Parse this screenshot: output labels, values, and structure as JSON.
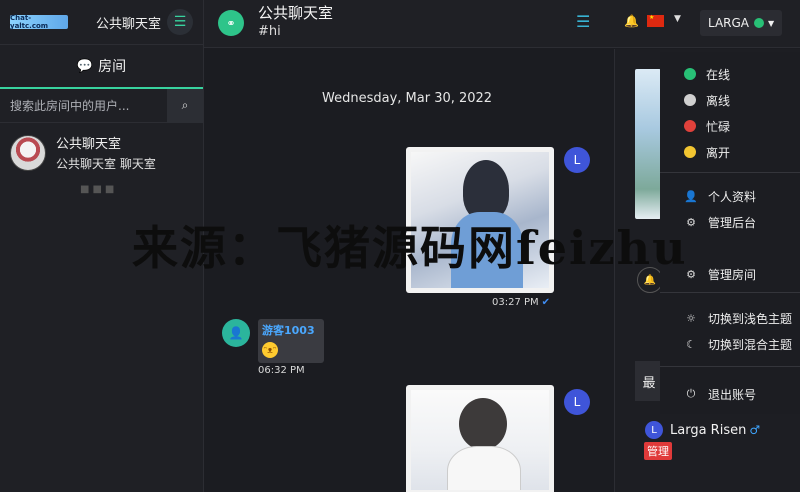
{
  "app": {
    "logo_text": "Chat-yaltc.com",
    "site_title": "公共聊天室"
  },
  "sidebar": {
    "rooms_tab": "房间",
    "search_placeholder": "搜索此房间中的用户...",
    "rooms": [
      {
        "name": "公共聊天室",
        "subtitle": "公共聊天室 聊天室"
      }
    ]
  },
  "header": {
    "room_title": "公共聊天室",
    "room_subtitle": "#hi",
    "user_label": "LARGA",
    "status_color": "#28c076"
  },
  "chat": {
    "date_separator": "Wednesday, Mar 30, 2022",
    "messages": [
      {
        "type": "image",
        "avatar": "L",
        "time": "03:27 PM",
        "read": true
      },
      {
        "type": "text",
        "sender": "游客1003",
        "content": "emoji",
        "time": "06:32 PM"
      },
      {
        "type": "image",
        "avatar": "L"
      }
    ]
  },
  "members": [
    {
      "avatar": "L",
      "name": "Larga Risen",
      "gender": "♂",
      "role": "管理"
    }
  ],
  "side": {
    "button_label": "最"
  },
  "menu": {
    "statuses": [
      {
        "label": "在线",
        "color": "#28c076"
      },
      {
        "label": "离线",
        "color": "#d0d0d0"
      },
      {
        "label": "忙碌",
        "color": "#e0413b"
      },
      {
        "label": "离开",
        "color": "#f2c531"
      }
    ],
    "items": [
      {
        "label": "个人资料",
        "icon": "user-icon"
      },
      {
        "label": "管理后台",
        "icon": "admin-icon"
      },
      {
        "label": "管理房间",
        "icon": "room-settings-icon"
      },
      {
        "label": "切换到浅色主题",
        "icon": "sun-icon"
      },
      {
        "label": "切换到混合主题",
        "icon": "moon-icon"
      },
      {
        "label": "退出账号",
        "icon": "power-icon"
      }
    ]
  },
  "watermark": "来源：飞猪源码网feizhu"
}
